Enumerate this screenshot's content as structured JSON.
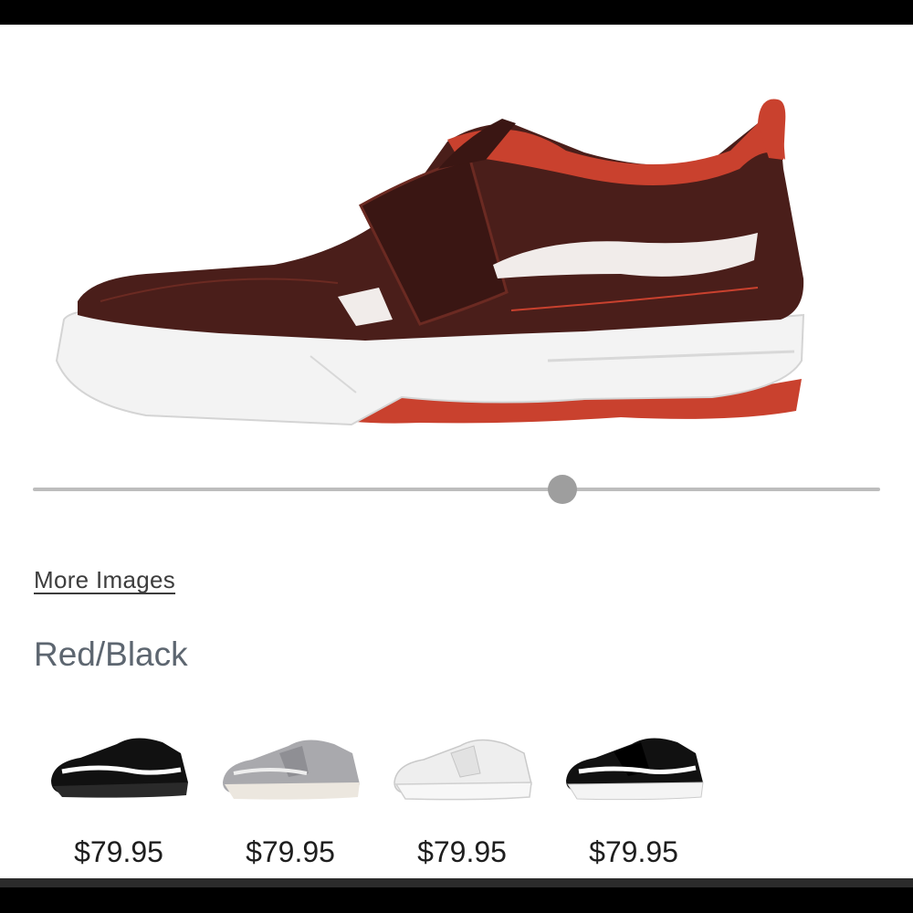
{
  "gallery": {
    "hero_image": "red-black-shoe-side-view",
    "slider_position": 0.59
  },
  "links": {
    "more_images": "More Images"
  },
  "selected_color": "Red/Black",
  "colorways": [
    {
      "image": "black-white-shoe",
      "price": "$79.95"
    },
    {
      "image": "grey-shoe",
      "price": "$79.95"
    },
    {
      "image": "white-shoe",
      "price": "$79.95"
    },
    {
      "image": "black-white-velcro-shoe",
      "price": "$79.95"
    }
  ],
  "colors": {
    "brown_leather": "#4a1e1a",
    "red_accent": "#c9412e",
    "sole_white": "#f2f2f2",
    "text_muted": "#5d6670",
    "slider_track": "#bdbdbd",
    "slider_knob": "#9e9e9e"
  }
}
